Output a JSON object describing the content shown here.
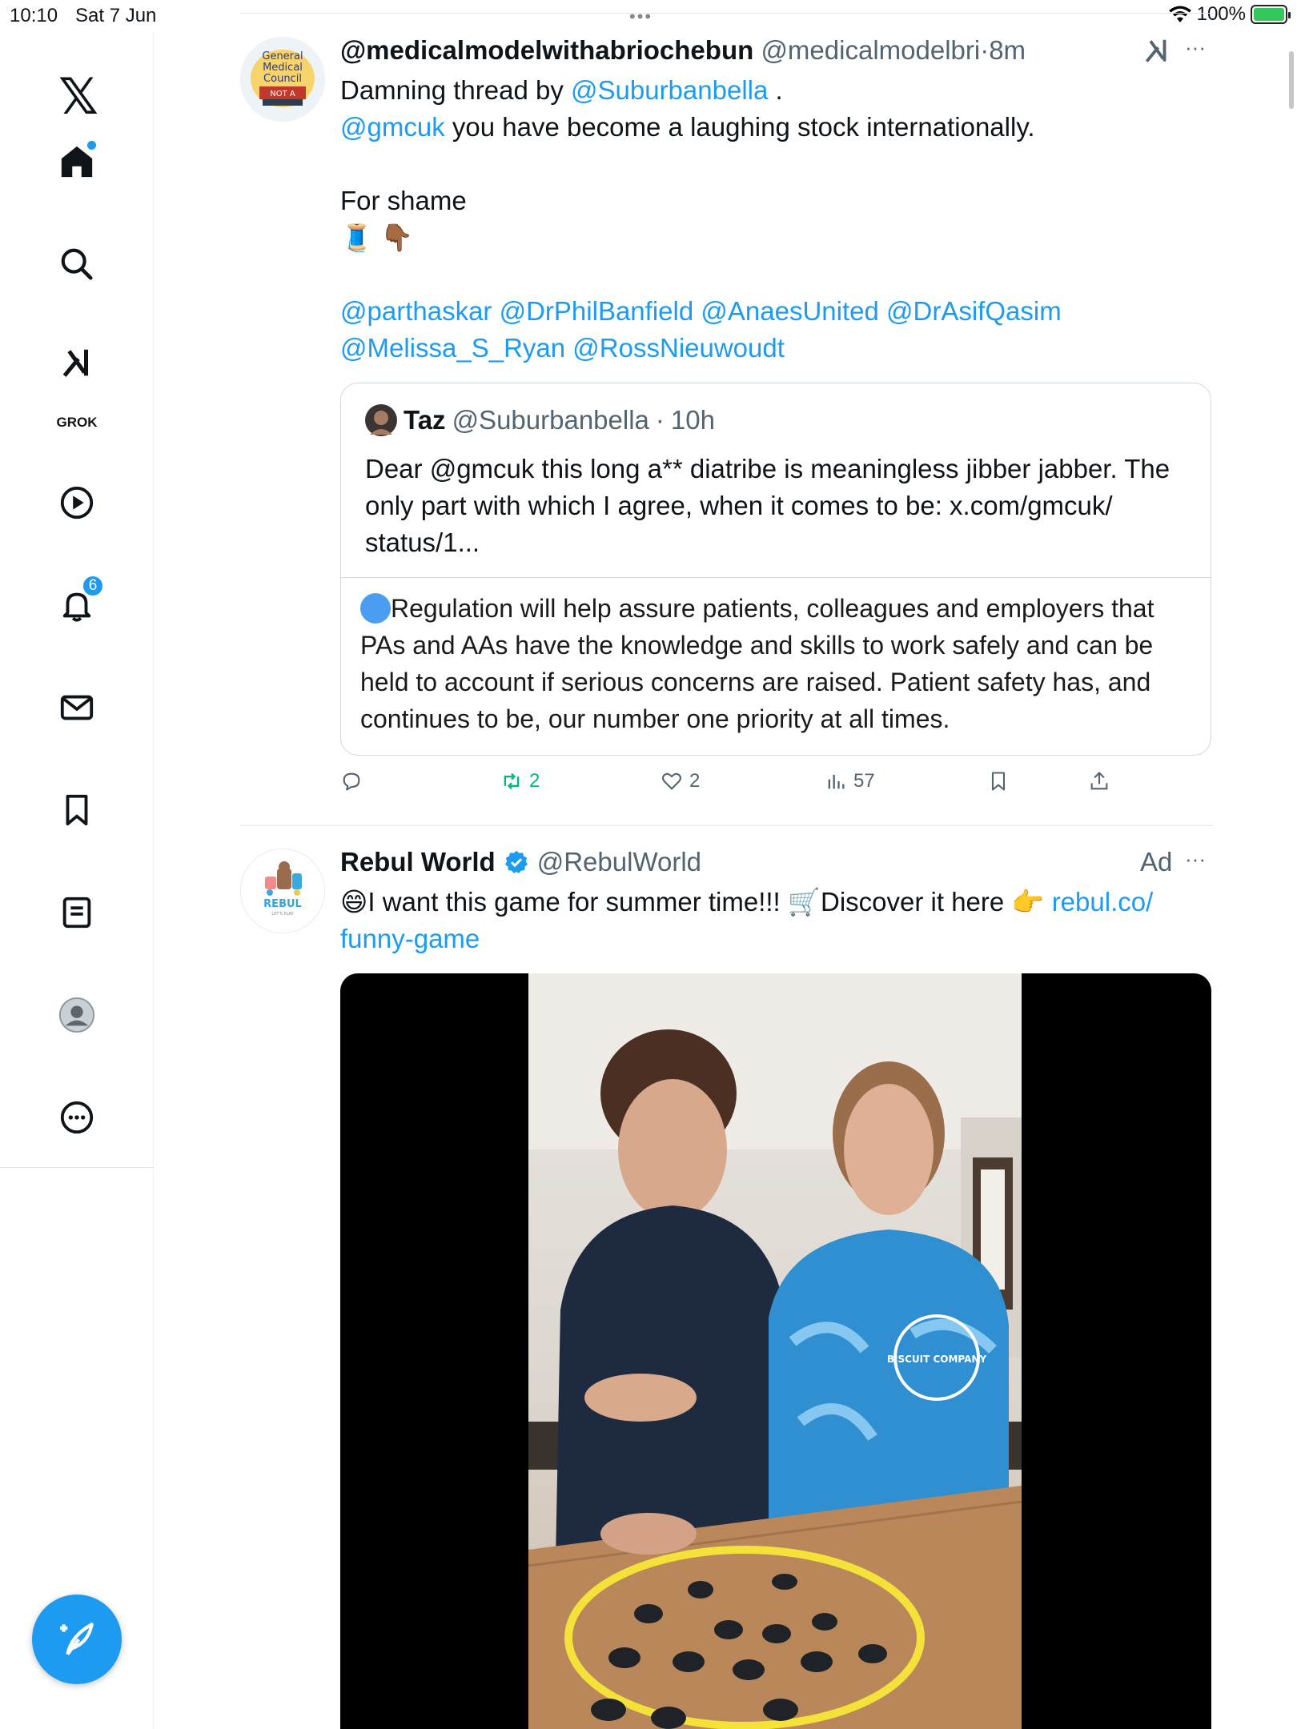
{
  "status_bar": {
    "time": "10:10",
    "date": "Sat 7 Jun",
    "battery": "100%"
  },
  "sidebar": {
    "grok_label": "GROK",
    "notifications_count": "6"
  },
  "tweet1": {
    "display_name": "@medicalmodelwithabriochebun",
    "handle": "@medicalmodelbri",
    "dot": "·",
    "time": "8m",
    "line1_prefix": "Damning thread by ",
    "line1_mention": "@Suburbanbella",
    "line1_suffix": " .",
    "line2_mention": "@gmcuk",
    "line2_text": " you have become a laughing stock internationally.",
    "line3": "For shame",
    "emojis": "🧵 👇🏾",
    "mentions_a": [
      "@parthaskar",
      "@DrPhilBanfield",
      "@AnaesUnited",
      "@DrAsifQasim"
    ],
    "mentions_b": [
      "@Melissa_S_Ryan",
      "@RossNieuwoudt"
    ],
    "quote": {
      "name": "Taz",
      "handle": "@Suburbanbella",
      "dot": "·",
      "time": "10h",
      "text_line1": "Dear @gmcuk this long a** diatribe is meaningless jibber jabber. The",
      "text_line2": "only part with which I agree, when it comes to be: x.com/gmcuk/",
      "text_line3": "status/1...",
      "embed_line1": "Regulation will help assure patients, colleagues and employers that",
      "embed_line2": "PAs and AAs have the knowledge and skills to work safely and can be",
      "embed_line3": "held to account if serious concerns are raised. Patient safety has, and",
      "embed_line4": "continues to be, our number one priority at all times."
    },
    "actions": {
      "retweets": "2",
      "likes": "2",
      "views": "57"
    }
  },
  "tweet2": {
    "display_name": "Rebul World",
    "handle": "@RebulWorld",
    "ad_label": "Ad",
    "text_emoji_start": "😄",
    "text_main": "I want this game for summer time!!! ",
    "text_emoji_cart": "🛒",
    "text_discover": "Discover it here ",
    "text_emoji_point": "👉",
    "link_part1": "rebul.co/",
    "link_part2": "funny-game",
    "avatar_brand": "REBUL",
    "avatar_tag": "LET'S PLAY",
    "shirt_text": "BISCUIT COMPANY"
  },
  "colors": {
    "accent": "#1d9bf0",
    "muted": "#536471",
    "retweet_green": "#00ba7c"
  }
}
